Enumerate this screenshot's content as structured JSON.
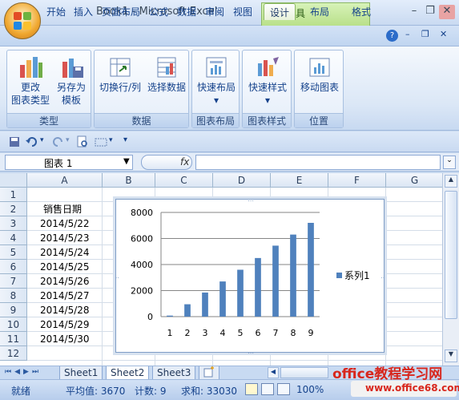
{
  "window": {
    "title": "Book1 - Microsoft Excel",
    "context_title": "图表工具"
  },
  "tabs": [
    "开始",
    "插入",
    "页面布局",
    "公式",
    "数据",
    "审阅",
    "视图",
    "设计",
    "布局",
    "格式"
  ],
  "active_tab": "设计",
  "ribbon": {
    "groups": [
      {
        "label": "类型",
        "buttons": [
          {
            "line1": "更改",
            "line2": "图表类型",
            "icon": "change-chart-type-icon"
          },
          {
            "line1": "另存为",
            "line2": "模板",
            "icon": "save-as-template-icon"
          }
        ]
      },
      {
        "label": "数据",
        "buttons": [
          {
            "line1": "切换行/列",
            "line2": "",
            "icon": "switch-row-column-icon"
          },
          {
            "line1": "选择数据",
            "line2": "",
            "icon": "select-data-icon"
          }
        ]
      },
      {
        "label": "图表布局",
        "buttons": [
          {
            "line1": "快速布局",
            "line2": "▾",
            "icon": "quick-layout-icon"
          }
        ]
      },
      {
        "label": "图表样式",
        "buttons": [
          {
            "line1": "快速样式",
            "line2": "▾",
            "icon": "quick-styles-icon"
          }
        ]
      },
      {
        "label": "位置",
        "buttons": [
          {
            "line1": "移动图表",
            "line2": "",
            "icon": "move-chart-icon"
          }
        ]
      }
    ]
  },
  "formula_bar": {
    "name_box": "图表 1",
    "fx": "fx",
    "formula": ""
  },
  "grid": {
    "columns": [
      "A",
      "B",
      "C",
      "D",
      "E",
      "F",
      "G"
    ],
    "rows": [
      "1",
      "2",
      "3",
      "4",
      "5",
      "6",
      "7",
      "8",
      "9",
      "10",
      "11",
      "12"
    ],
    "a_cells": [
      "",
      "销售日期",
      "2014/5/22",
      "2014/5/23",
      "2014/5/24",
      "2014/5/25",
      "2014/5/26",
      "2014/5/27",
      "2014/5/28",
      "2014/5/29",
      "2014/5/30",
      ""
    ]
  },
  "chart_data": {
    "type": "bar",
    "categories": [
      "1",
      "2",
      "3",
      "4",
      "5",
      "6",
      "7",
      "8",
      "9"
    ],
    "series": [
      {
        "name": "系列1",
        "values": [
          80,
          950,
          1850,
          2700,
          3600,
          4500,
          5450,
          6300,
          7200
        ]
      }
    ],
    "ylim": [
      0,
      8000
    ],
    "yticks": [
      "0",
      "2000",
      "4000",
      "6000",
      "8000"
    ],
    "grid": true,
    "legend": "right",
    "color": "#4f81bd"
  },
  "sheets": [
    "Sheet1",
    "Sheet2",
    "Sheet3"
  ],
  "active_sheet": "Sheet2",
  "status": {
    "mode": "就绪",
    "average": "平均值: 3670",
    "count": "计数: 9",
    "sum": "求和: 33030",
    "zoom": "100%"
  },
  "watermark": {
    "line1": "office教程学习网",
    "line2": "www.office68.com"
  }
}
